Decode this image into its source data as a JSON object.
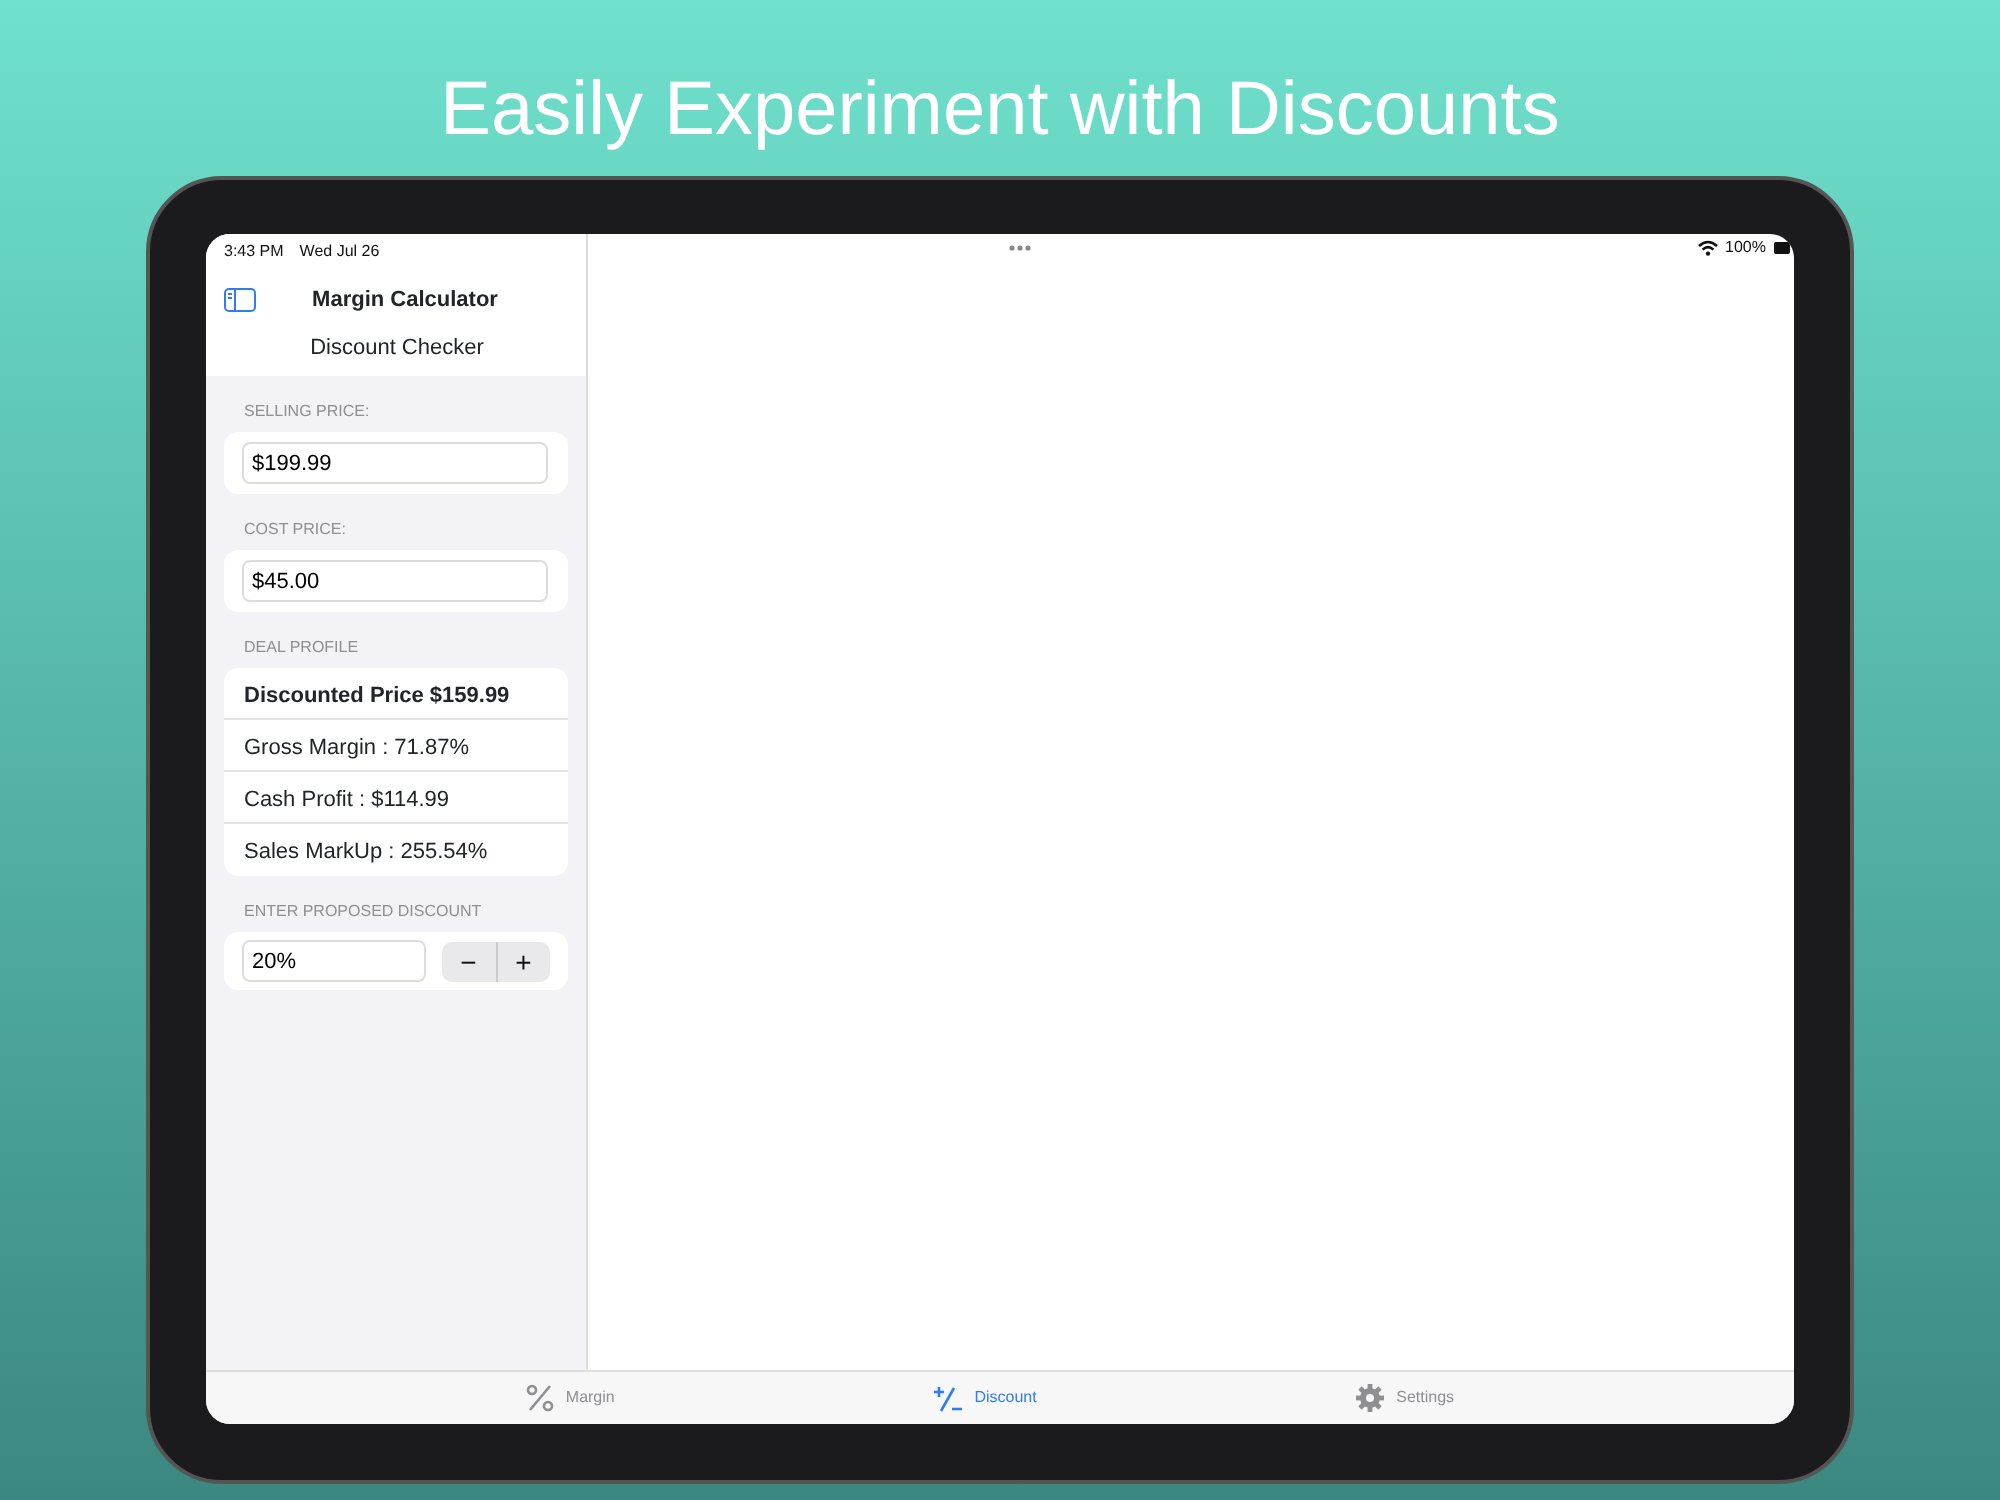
{
  "headline": "Easily Experiment with Discounts",
  "status_bar": {
    "time": "3:43 PM",
    "date": "Wed Jul 26",
    "battery": "100%"
  },
  "sidebar": {
    "title": "Margin Calculator",
    "subtitle": "Discount Checker",
    "sections": [
      {
        "kind": "field",
        "label": "SELLING PRICE:",
        "value": "$199.99"
      },
      {
        "kind": "field",
        "label": "COST PRICE:",
        "value": "$45.00"
      },
      {
        "kind": "list",
        "label": "DEAL PROFILE",
        "rows": [
          {
            "text": "Discounted Price $159.99",
            "bold": true
          },
          {
            "text": "Gross Margin : 71.87%",
            "bold": false
          },
          {
            "text": "Cash Profit : $114.99",
            "bold": false
          },
          {
            "text": "Sales MarkUp : 255.54%",
            "bold": false
          }
        ]
      },
      {
        "kind": "stepper",
        "label": "ENTER PROPOSED DISCOUNT",
        "value": "20%",
        "decrement": "−",
        "increment": "+"
      }
    ]
  },
  "tab_bar": [
    {
      "kind": "percent",
      "label": "Margin",
      "selected": false
    },
    {
      "kind": "plusminus",
      "label": "Discount",
      "selected": true
    },
    {
      "kind": "gear",
      "label": "Settings",
      "selected": false
    }
  ]
}
